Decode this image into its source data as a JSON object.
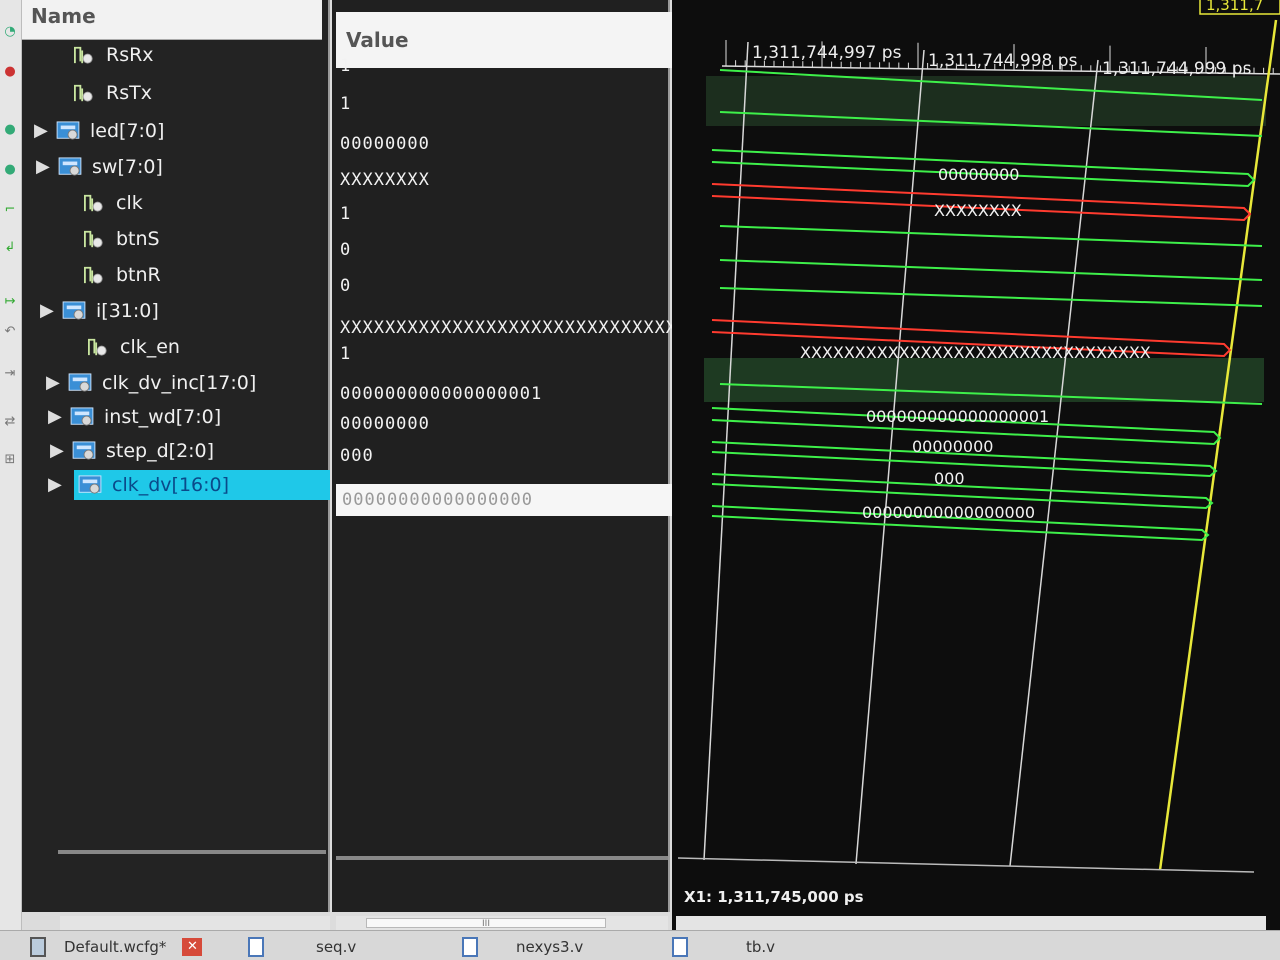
{
  "columns": {
    "name": "Name",
    "value": "Value"
  },
  "signals": [
    {
      "name": "RsRx",
      "value": "1",
      "expandable": false,
      "icon": "scalar-signal-icon"
    },
    {
      "name": "RsTx",
      "value": "1",
      "expandable": false,
      "icon": "scalar-signal-icon"
    },
    {
      "name": "led[7:0]",
      "value": "00000000",
      "expandable": true,
      "icon": "bus-signal-icon"
    },
    {
      "name": "sw[7:0]",
      "value": "XXXXXXXX",
      "expandable": true,
      "icon": "bus-signal-icon"
    },
    {
      "name": "clk",
      "value": "1",
      "expandable": false,
      "icon": "scalar-signal-icon"
    },
    {
      "name": "btnS",
      "value": "0",
      "expandable": false,
      "icon": "scalar-signal-icon"
    },
    {
      "name": "btnR",
      "value": "0",
      "expandable": false,
      "icon": "scalar-signal-icon"
    },
    {
      "name": "i[31:0]",
      "value": "XXXXXXXXXXXXXXXXXXXXXXXXXXXXXXXX",
      "expandable": true,
      "icon": "bus-signal-icon"
    },
    {
      "name": "clk_en",
      "value": "1",
      "expandable": false,
      "icon": "scalar-signal-icon"
    },
    {
      "name": "clk_dv_inc[17:0]",
      "value": "000000000000000001",
      "expandable": true,
      "icon": "bus-signal-icon"
    },
    {
      "name": "inst_wd[7:0]",
      "value": "00000000",
      "expandable": true,
      "icon": "bus-signal-icon"
    },
    {
      "name": "step_d[2:0]",
      "value": "000",
      "expandable": true,
      "icon": "bus-signal-icon"
    },
    {
      "name": "clk_dv[16:0]",
      "value": "00000000000000000",
      "expandable": true,
      "icon": "bus-signal-icon",
      "selected": true
    }
  ],
  "waveform": {
    "time_labels": [
      "1,311,744,997 ps",
      "1,311,744,998 ps",
      "1,311,744,999 ps"
    ],
    "top_clip_label": "1,311,7",
    "bus_labels": {
      "led": "00000000",
      "sw": "XXXXXXXX",
      "i": "XXXXXXXXXXXXXXXXXXXXXXXXXXXXXXXX",
      "clk_dv_inc": "000000000000000001",
      "inst_wd": "00000000",
      "step_d": "000",
      "clk_dv": "00000000000000000"
    },
    "colors": {
      "logic": "#3ef04a",
      "unknown": "#ff3b2f",
      "cursor": "#e8e83a",
      "grid": "#d8d8d8"
    }
  },
  "cursor": {
    "readout": "X1: 1,311,745,000 ps"
  },
  "tabs": [
    {
      "label": "Default.wcfg*"
    },
    {
      "label": "seq.v"
    },
    {
      "label": "nexys3.v"
    },
    {
      "label": "tb.v"
    }
  ],
  "scroll": {
    "thumb_label": "III"
  }
}
